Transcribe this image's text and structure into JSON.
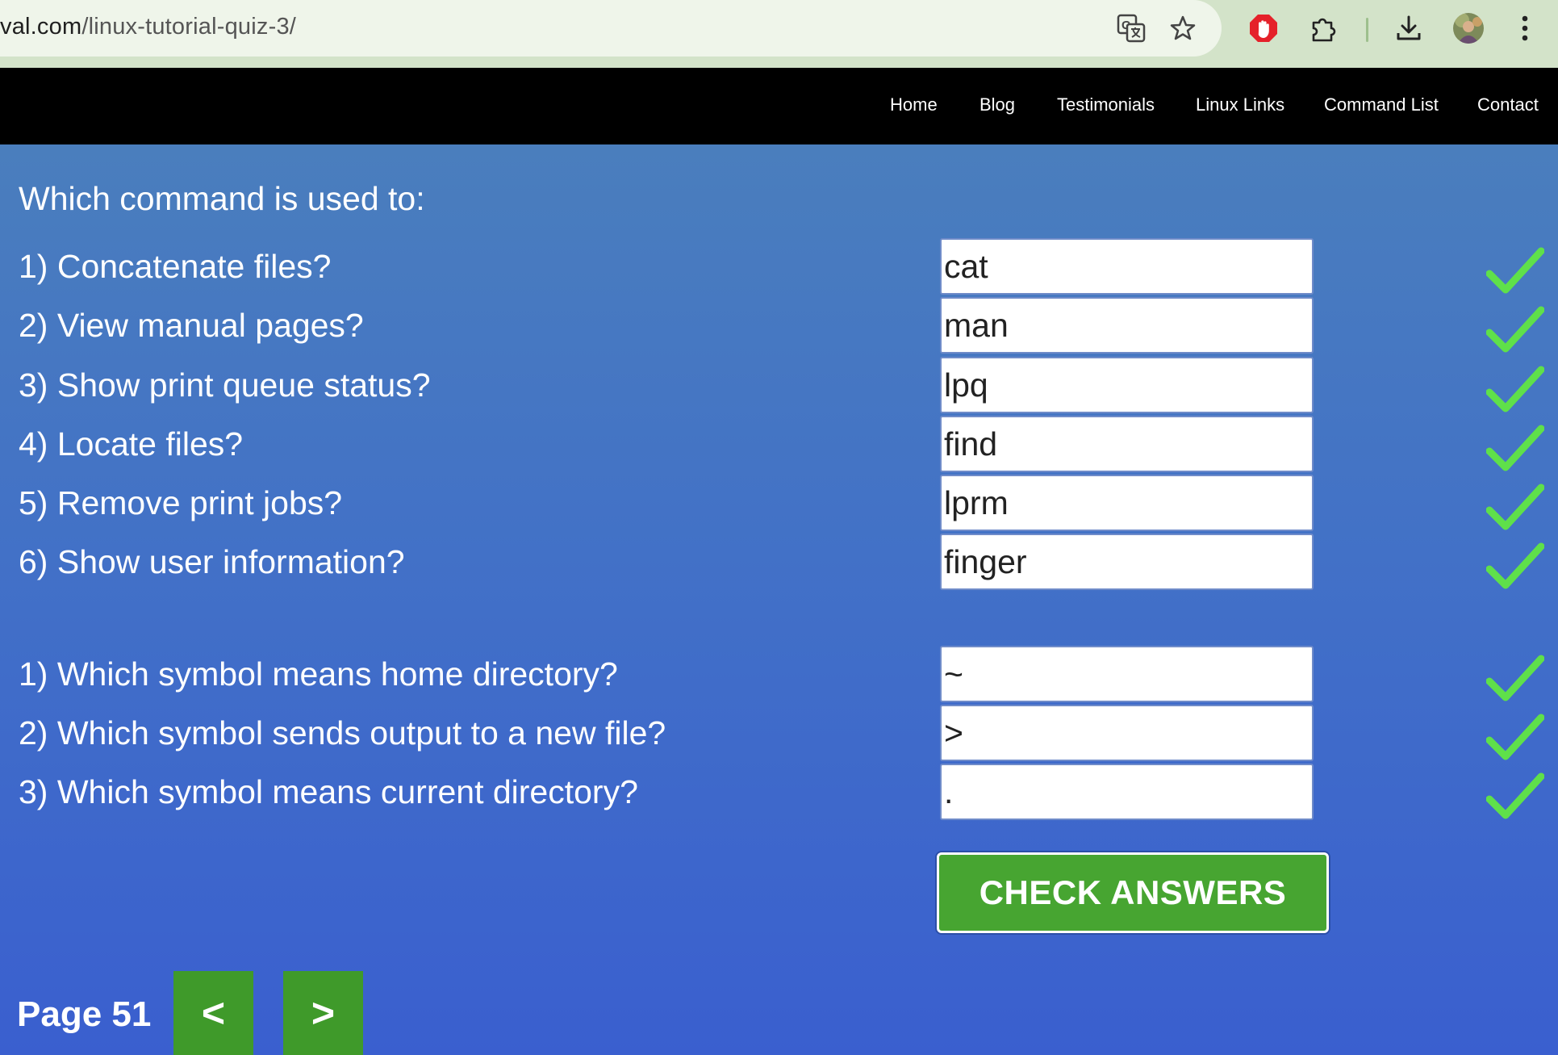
{
  "browser": {
    "url_host": "val.com",
    "url_path": "/linux-tutorial-quiz-3/",
    "icons": [
      "translate-icon",
      "star-icon",
      "adblock-icon",
      "extensions-icon",
      "download-icon",
      "avatar",
      "menu-icon"
    ]
  },
  "nav": {
    "items": [
      {
        "label": "Home"
      },
      {
        "label": "Blog"
      },
      {
        "label": "Testimonials"
      },
      {
        "label": "Linux Links"
      },
      {
        "label": "Command List"
      },
      {
        "label": "Contact"
      }
    ]
  },
  "quiz": {
    "heading": "Which command is used to:",
    "commands": [
      {
        "question": "1) Concatenate files?",
        "answer": "cat",
        "correct": true
      },
      {
        "question": "2) View manual pages?",
        "answer": "man",
        "correct": true
      },
      {
        "question": "3) Show print queue status?",
        "answer": "lpq",
        "correct": true
      },
      {
        "question": "4) Locate files?",
        "answer": "find",
        "correct": true
      },
      {
        "question": "5) Remove print jobs?",
        "answer": "lprm",
        "correct": true
      },
      {
        "question": "6) Show user information?",
        "answer": "finger",
        "correct": true
      }
    ],
    "symbols": [
      {
        "question": "1) Which symbol means home directory?",
        "answer": "~",
        "correct": true
      },
      {
        "question": "2) Which symbol sends output to a new file?",
        "answer": ">",
        "correct": true
      },
      {
        "question": "3) Which symbol means current directory?",
        "answer": ".",
        "correct": true
      }
    ],
    "check_button": "CHECK ANSWERS",
    "check_color": "#47a531",
    "tick_color": "#5fe04a"
  },
  "pager": {
    "label": "Page 51",
    "prev": "<",
    "next": ">"
  }
}
